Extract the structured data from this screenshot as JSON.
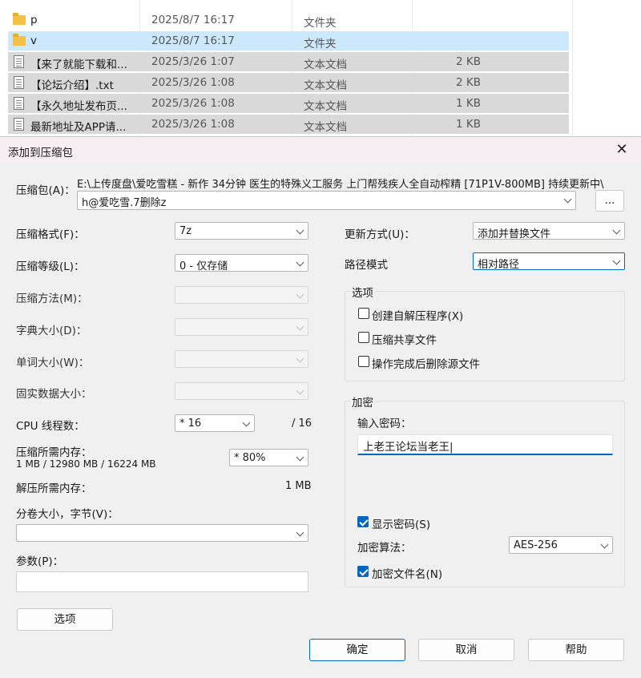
{
  "explorer": {
    "rows": [
      {
        "name": "p",
        "date": "2025/8/7 16:17",
        "type": "文件夹",
        "size": "",
        "icon": "folder-icon"
      },
      {
        "name": "v",
        "date": "2025/8/7 16:17",
        "type": "文件夹",
        "size": "",
        "icon": "folder-icon"
      },
      {
        "name": "【来了就能下载和...",
        "date": "2025/3/26 1:07",
        "type": "文本文档",
        "size": "2 KB",
        "icon": "text-file-icon"
      },
      {
        "name": "【论坛介绍】.txt",
        "date": "2025/3/26 1:08",
        "type": "文本文档",
        "size": "2 KB",
        "icon": "text-file-icon"
      },
      {
        "name": "【永久地址发布页...",
        "date": "2025/3/26 1:08",
        "type": "文本文档",
        "size": "1 KB",
        "icon": "text-file-icon"
      },
      {
        "name": "最新地址及APP请...",
        "date": "2025/3/26 1:08",
        "type": "文本文档",
        "size": "1 KB",
        "icon": "text-file-icon"
      }
    ]
  },
  "dialog": {
    "title": "添加到压缩包",
    "close_glyph": "✕",
    "archive_label": "压缩包(A)：",
    "archive_path": "E:\\上传度盘\\爱吃雪糕 - 新作 34分钟 医生的特殊义工服务 上门帮残疾人全自动榨精 [71P1V-800MB] 持续更新中\\",
    "archive_name": "h@爱吃雪.7删除z",
    "browse_label": "...",
    "format_label": "压缩格式(F)：",
    "format_value": "7z",
    "level_label": "压缩等级(L)：",
    "level_value": "0 - 仅存储",
    "method_label": "压缩方法(M)：",
    "dict_label": "字典大小(D)：",
    "word_label": "单词大小(W)：",
    "solid_label": "固实数据大小：",
    "threads_label": "CPU 线程数：",
    "threads_value": "* 16",
    "threads_total": "/ 16",
    "mem_comp_label": "压缩所需内存：",
    "mem_comp_detail": "1 MB / 12980 MB / 16224 MB",
    "mem_comp_value": "* 80%",
    "mem_decomp_label": "解压所需内存：",
    "mem_decomp_value": "1 MB",
    "split_label": "分卷大小，字节(V)：",
    "split_value": "",
    "params_label": "参数(P)：",
    "params_value": "",
    "options_button": "选项",
    "update_label": "更新方式(U)：",
    "update_value": "添加并替换文件",
    "pathmode_label": "路径模式",
    "pathmode_value": "相对路径",
    "options_group": "选项",
    "opt_sfx": "创建自解压程序(X)",
    "opt_shared": "压缩共享文件",
    "opt_delete": "操作完成后删除源文件",
    "encrypt_group": "加密",
    "password_label": "输入密码：",
    "password_value": "上老王论坛当老王|",
    "show_password": "显示密码(S)",
    "enc_method_label": "加密算法：",
    "enc_method_value": "AES-256",
    "encrypt_names": "加密文件名(N)",
    "ok_button": "确定",
    "cancel_button": "取消",
    "help_button": "帮助"
  }
}
